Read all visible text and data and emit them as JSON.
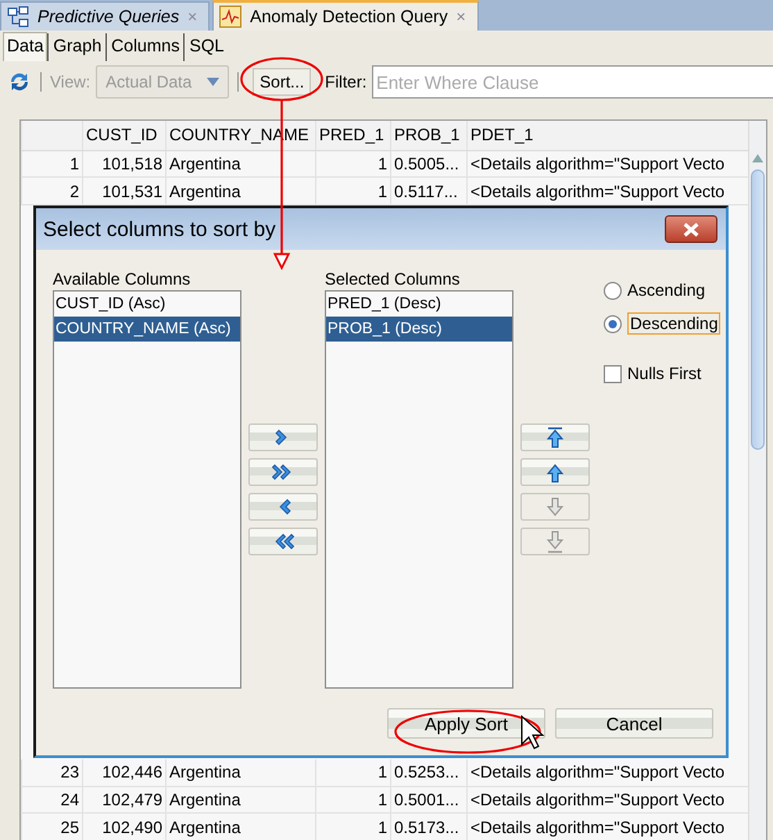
{
  "editor_tabs": [
    {
      "label": "Predictive Queries",
      "selected": false,
      "close": "×"
    },
    {
      "label": "Anomaly Detection Query",
      "selected": true,
      "close": "×"
    }
  ],
  "view_tabs": [
    {
      "label": "Data",
      "selected": true
    },
    {
      "label": "Graph",
      "selected": false
    },
    {
      "label": "Columns",
      "selected": false
    },
    {
      "label": "SQL",
      "selected": false
    }
  ],
  "toolbar": {
    "view_label": "View:",
    "view_value": "Actual Data",
    "view_disabled": true,
    "sort_button": "Sort...",
    "filter_label": "Filter:",
    "filter_placeholder": "Enter Where Clause"
  },
  "table": {
    "columns": [
      "CUST_ID",
      "COUNTRY_NAME",
      "PRED_1",
      "PROB_1",
      "PDET_1"
    ],
    "rows_top": [
      {
        "row": "1",
        "cells": [
          "101,518",
          "Argentina",
          "1",
          "0.5005...",
          "<Details algorithm=\"Support Vecto"
        ]
      },
      {
        "row": "2",
        "cells": [
          "101,531",
          "Argentina",
          "1",
          "0.5117...",
          "<Details algorithm=\"Support Vecto"
        ]
      }
    ],
    "rows_bottom": [
      {
        "row": "23",
        "cells": [
          "102,446",
          "Argentina",
          "1",
          "0.5253...",
          "<Details algorithm=\"Support Vecto"
        ]
      },
      {
        "row": "24",
        "cells": [
          "102,479",
          "Argentina",
          "1",
          "0.5001...",
          "<Details algorithm=\"Support Vecto"
        ]
      },
      {
        "row": "25",
        "cells": [
          "102,490",
          "Argentina",
          "1",
          "0.5173...",
          "<Details algorithm=\"Support Vecto"
        ]
      }
    ]
  },
  "dialog": {
    "title": "Select columns to sort by",
    "available_label": "Available Columns",
    "available_items": [
      {
        "label": "CUST_ID (Asc)",
        "selected": false
      },
      {
        "label": "COUNTRY_NAME (Asc)",
        "selected": true
      }
    ],
    "selected_label": "Selected Columns",
    "selected_items": [
      {
        "label": "PRED_1 (Desc)",
        "selected": false
      },
      {
        "label": "PROB_1 (Desc)",
        "selected": true
      }
    ],
    "move_buttons": [
      {
        "kind": "add"
      },
      {
        "kind": "add_all"
      },
      {
        "kind": "remove"
      },
      {
        "kind": "remove_all"
      }
    ],
    "order_buttons": [
      {
        "kind": "top",
        "disabled": false
      },
      {
        "kind": "up",
        "disabled": false
      },
      {
        "kind": "down",
        "disabled": true
      },
      {
        "kind": "bottom",
        "disabled": true
      }
    ],
    "order_options": [
      {
        "label": "Ascending",
        "selected": false,
        "focused": false
      },
      {
        "label": "Descending",
        "selected": true,
        "focused": true
      }
    ],
    "nulls_first": {
      "label": "Nulls First",
      "checked": false
    },
    "apply_button": "Apply Sort",
    "cancel_button": "Cancel"
  }
}
